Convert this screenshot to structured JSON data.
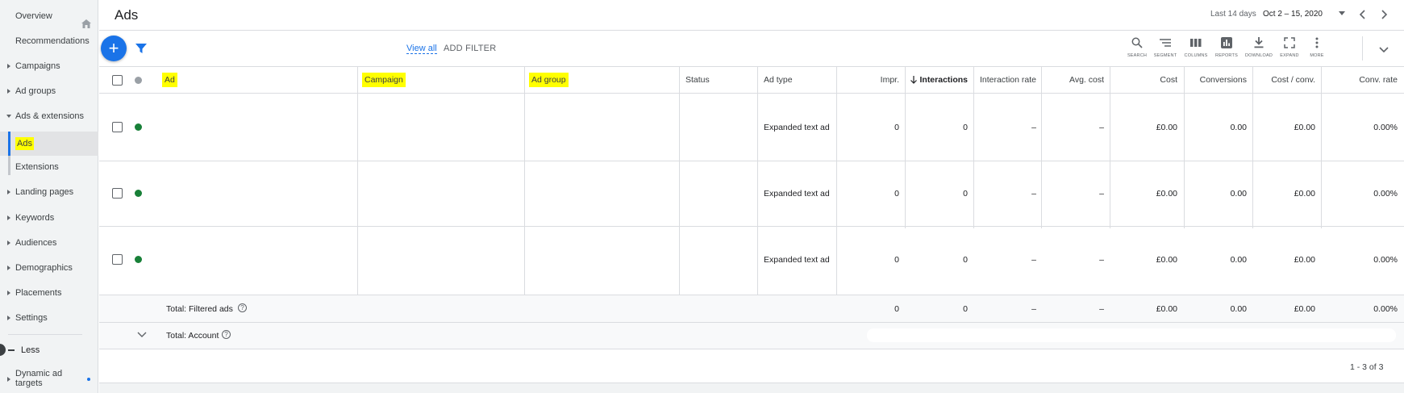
{
  "sidebar": {
    "overview": "Overview",
    "recommendations": "Recommendations",
    "campaigns": "Campaigns",
    "ad_groups": "Ad groups",
    "ads_extensions": "Ads & extensions",
    "ads": "Ads",
    "extensions": "Extensions",
    "landing_pages": "Landing pages",
    "keywords": "Keywords",
    "audiences": "Audiences",
    "demographics": "Demographics",
    "placements": "Placements",
    "settings": "Settings",
    "less": "Less",
    "dynamic_ad_targets": "Dynamic ad targets"
  },
  "header": {
    "title": "Ads",
    "date_caption": "Last 14 days",
    "date_range": "Oct 2 – 15, 2020"
  },
  "toolbar": {
    "view_all": "View all",
    "add_filter": "ADD FILTER",
    "tools": [
      "SEARCH",
      "SEGMENT",
      "COLUMNS",
      "REPORTS",
      "DOWNLOAD",
      "EXPAND",
      "MORE"
    ]
  },
  "table": {
    "columns": {
      "ad": "Ad",
      "campaign": "Campaign",
      "ad_group": "Ad group",
      "status": "Status",
      "ad_type": "Ad type",
      "impr": "Impr.",
      "interactions": "Interactions",
      "interaction_rate": "Interaction rate",
      "avg_cost": "Avg. cost",
      "cost": "Cost",
      "conversions": "Conversions",
      "cost_conv": "Cost / conv.",
      "conv_rate": "Conv. rate"
    },
    "rows": [
      {
        "ad_type": "Expanded text ad",
        "impr": "0",
        "interactions": "0",
        "interaction_rate": "–",
        "avg_cost": "–",
        "cost": "£0.00",
        "conversions": "0.00",
        "cost_conv": "£0.00",
        "conv_rate": "0.00%"
      },
      {
        "ad_type": "Expanded text ad",
        "impr": "0",
        "interactions": "0",
        "interaction_rate": "–",
        "avg_cost": "–",
        "cost": "£0.00",
        "conversions": "0.00",
        "cost_conv": "£0.00",
        "conv_rate": "0.00%"
      },
      {
        "ad_type": "Expanded text ad",
        "impr": "0",
        "interactions": "0",
        "interaction_rate": "–",
        "avg_cost": "–",
        "cost": "£0.00",
        "conversions": "0.00",
        "cost_conv": "£0.00",
        "conv_rate": "0.00%"
      }
    ],
    "total_filtered": {
      "label": "Total: Filtered ads",
      "impr": "0",
      "interactions": "0",
      "interaction_rate": "–",
      "avg_cost": "–",
      "cost": "£0.00",
      "conversions": "0.00",
      "cost_conv": "£0.00",
      "conv_rate": "0.00%"
    },
    "total_account": {
      "label": "Total: Account"
    },
    "pagination": "1 - 3 of 3"
  },
  "colors": {
    "accent": "#1a73e8",
    "enabled": "#188038",
    "highlight": "#ffff00"
  }
}
